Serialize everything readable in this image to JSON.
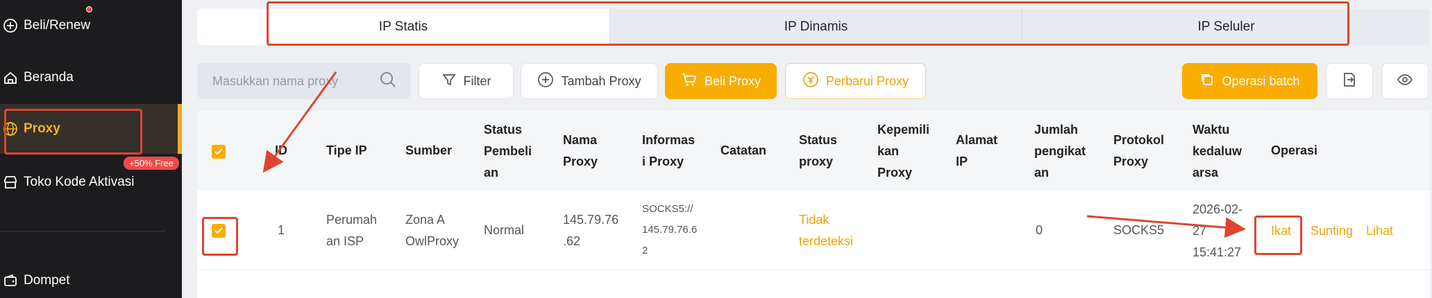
{
  "sidebar": {
    "items": [
      {
        "label": "Beli/Renew",
        "icon": "plus-circle-icon"
      },
      {
        "label": "Beranda",
        "icon": "home-icon"
      },
      {
        "label": "Proxy",
        "icon": "globe-icon"
      },
      {
        "label": "Toko Kode Aktivasi",
        "icon": "store-icon"
      },
      {
        "label": "Dompet",
        "icon": "wallet-icon"
      }
    ],
    "badge": "+50% Free"
  },
  "tabs": [
    "IP Statis",
    "IP Dinamis",
    "IP Seluler"
  ],
  "toolbar": {
    "search_placeholder": "Masukkan nama proxy",
    "filter": "Filter",
    "add_proxy": "Tambah Proxy",
    "buy_proxy": "Beli Proxy",
    "renew_proxy": "Perbarui Proxy",
    "batch": "Operasi batch"
  },
  "table": {
    "headers": {
      "id": "ID",
      "type": "Tipe IP",
      "source": "Sumber",
      "purchase_status": [
        "Status",
        "Pembeli",
        "an"
      ],
      "proxy_name": [
        "Nama",
        "Proxy"
      ],
      "proxy_info": [
        "Informas",
        "i Proxy"
      ],
      "notes": "Catatan",
      "proxy_status": [
        "Status",
        "proxy"
      ],
      "ownership": [
        "Kepemili",
        "kan",
        "Proxy"
      ],
      "ip_address": [
        "Alamat",
        "IP"
      ],
      "bind_count": [
        "Jumlah",
        "pengikat",
        "an"
      ],
      "protocol": [
        "Protokol",
        "Proxy"
      ],
      "expiry": [
        "Waktu",
        "kedaluw",
        "arsa"
      ],
      "operations": "Operasi"
    },
    "rows": [
      {
        "id": "1",
        "type": [
          "Perumah",
          "an ISP"
        ],
        "source": [
          "Zona A",
          "OwlProxy"
        ],
        "purchase_status": "Normal",
        "proxy_name": [
          "145.79.76",
          ".62"
        ],
        "proxy_info": [
          "SOCKS5://",
          "145.79.76.6",
          "2"
        ],
        "proxy_status": [
          "Tidak",
          "terdeteksi"
        ],
        "bind_count": "0",
        "protocol": "SOCKS5",
        "expiry": [
          "2026-02-",
          "27",
          "15:41:27"
        ],
        "ops": [
          "Ikat",
          "Sunting",
          "Lihat"
        ]
      }
    ]
  },
  "colors": {
    "accent": "#f9ad00",
    "annotation": "#e0442e",
    "sidebar": "#1c1c1e"
  }
}
